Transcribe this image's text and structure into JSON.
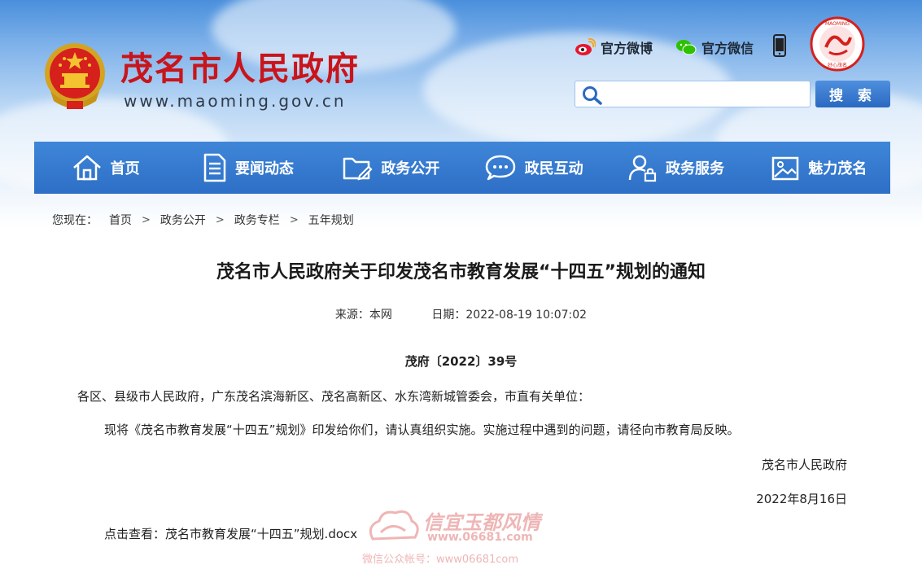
{
  "header": {
    "site_title": "茂名市人民政府",
    "site_url": "www.maoming.gov.cn",
    "weibo_label": "官方微博",
    "wechat_label": "官方微信",
    "badge_arc_text": "MAOMING",
    "badge_bottom_text": "好心茂名",
    "search": {
      "placeholder": "",
      "button_label": "搜 索"
    }
  },
  "nav": {
    "items": [
      {
        "label": "首页",
        "icon": "home-icon"
      },
      {
        "label": "要闻动态",
        "icon": "document-icon"
      },
      {
        "label": "政务公开",
        "icon": "folder-edit-icon"
      },
      {
        "label": "政民互动",
        "icon": "chat-bubble-icon"
      },
      {
        "label": "政务服务",
        "icon": "user-lock-icon"
      },
      {
        "label": "魅力茂名",
        "icon": "picture-icon"
      }
    ]
  },
  "breadcrumb": {
    "prefix": "您现在：",
    "items": [
      "首页",
      "政务公开",
      "政务专栏",
      "五年规划"
    ]
  },
  "article": {
    "title": "茂名市人民政府关于印发茂名市教育发展“十四五”规划的通知",
    "source": "来源：本网",
    "date": "日期：2022-08-19 10:07:02",
    "doc_number": "茂府〔2022〕39号",
    "addressee": "各区、县级市人民政府，广东茂名滨海新区、茂名高新区、水东湾新城管委会，市直有关单位：",
    "body": "现将《茂名市教育发展“十四五”规划》印发给你们，请认真组织实施。实施过程中遇到的问题，请径向市教育局反映。",
    "sign_org": "茂名市人民政府",
    "sign_date": "2022年8月16日",
    "attachment_prefix": "点击查看：",
    "attachment_link": "茂名市教育发展“十四五”规划.docx"
  },
  "watermark": {
    "title": "信宜玉都风情",
    "url": "www.06681.com",
    "sub": "微信公众帐号：www06681com"
  },
  "colors": {
    "title_red": "#c8151b",
    "nav_blue": "#2d6fc6",
    "button_blue": "#2a69c1"
  }
}
